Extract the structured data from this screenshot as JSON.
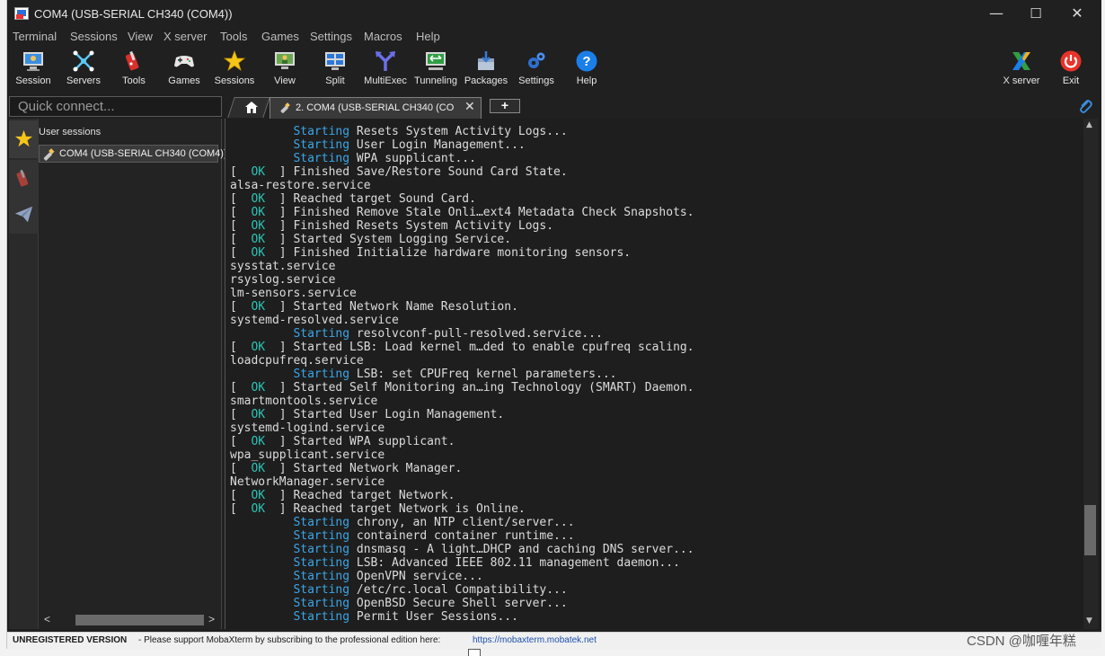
{
  "window": {
    "title": "COM4  (USB-SERIAL CH340 (COM4))",
    "controls": {
      "minimize": "—",
      "maximize": "☐",
      "close": "✕"
    }
  },
  "menubar": [
    "Terminal",
    "Sessions",
    "View",
    "X server",
    "Tools",
    "Games",
    "Settings",
    "Macros",
    "Help"
  ],
  "toolbar": {
    "items": [
      {
        "label": "Session",
        "icon": "session-monitor-icon"
      },
      {
        "label": "Servers",
        "icon": "servers-network-icon"
      },
      {
        "label": "Tools",
        "icon": "tools-knife-icon"
      },
      {
        "label": "Games",
        "icon": "gamepad-icon"
      },
      {
        "label": "Sessions",
        "icon": "star-icon"
      },
      {
        "label": "View",
        "icon": "view-monitor-icon"
      },
      {
        "label": "Split",
        "icon": "split-window-icon"
      },
      {
        "label": "MultiExec",
        "icon": "fork-arrows-icon"
      },
      {
        "label": "Tunneling",
        "icon": "tunnel-monitor-icon"
      },
      {
        "label": "Packages",
        "icon": "package-download-icon"
      },
      {
        "label": "Settings",
        "icon": "gears-icon"
      },
      {
        "label": "Help",
        "icon": "help-question-icon"
      }
    ],
    "right_items": [
      {
        "label": "X server",
        "icon": "x-server-icon"
      },
      {
        "label": "Exit",
        "icon": "power-icon"
      }
    ]
  },
  "quick_connect": {
    "placeholder": "Quick connect..."
  },
  "tabs": {
    "active_label": "2. COM4  (USB-SERIAL CH340 (CO",
    "close_glyph": "✕",
    "new_tab_glyph": "+"
  },
  "sessions_panel": {
    "header": "User sessions",
    "items": [
      {
        "label": "COM4  (USB-SERIAL CH340 (COM4))"
      }
    ],
    "scroll_left": "<",
    "scroll_right": ">"
  },
  "terminal": {
    "lines": [
      {
        "pre": "         ",
        "tag": "Starting",
        "rest": " Resets System Activity Logs...",
        "kind": "start"
      },
      {
        "pre": "         ",
        "tag": "Starting",
        "rest": " User Login Management...",
        "kind": "start"
      },
      {
        "pre": "         ",
        "tag": "Starting",
        "rest": " WPA supplicant...",
        "kind": "start"
      },
      {
        "pre": "[  ",
        "tag": "OK",
        "rest": "  ] Finished Save/Restore Sound Card State.",
        "kind": "ok"
      },
      {
        "pre": "alsa-restore.service",
        "tag": "",
        "rest": "",
        "kind": "plain"
      },
      {
        "pre": "[  ",
        "tag": "OK",
        "rest": "  ] Reached target Sound Card.",
        "kind": "ok"
      },
      {
        "pre": "[  ",
        "tag": "OK",
        "rest": "  ] Finished Remove Stale Onli…ext4 Metadata Check Snapshots.",
        "kind": "ok"
      },
      {
        "pre": "[  ",
        "tag": "OK",
        "rest": "  ] Finished Resets System Activity Logs.",
        "kind": "ok"
      },
      {
        "pre": "[  ",
        "tag": "OK",
        "rest": "  ] Started System Logging Service.",
        "kind": "ok"
      },
      {
        "pre": "[  ",
        "tag": "OK",
        "rest": "  ] Finished Initialize hardware monitoring sensors.",
        "kind": "ok"
      },
      {
        "pre": "sysstat.service",
        "tag": "",
        "rest": "",
        "kind": "plain"
      },
      {
        "pre": "rsyslog.service",
        "tag": "",
        "rest": "",
        "kind": "plain"
      },
      {
        "pre": "lm-sensors.service",
        "tag": "",
        "rest": "",
        "kind": "plain"
      },
      {
        "pre": "[  ",
        "tag": "OK",
        "rest": "  ] Started Network Name Resolution.",
        "kind": "ok"
      },
      {
        "pre": "systemd-resolved.service",
        "tag": "",
        "rest": "",
        "kind": "plain"
      },
      {
        "pre": "         ",
        "tag": "Starting",
        "rest": " resolvconf-pull-resolved.service...",
        "kind": "start"
      },
      {
        "pre": "[  ",
        "tag": "OK",
        "rest": "  ] Started LSB: Load kernel m…ded to enable cpufreq scaling.",
        "kind": "ok"
      },
      {
        "pre": "loadcpufreq.service",
        "tag": "",
        "rest": "",
        "kind": "plain"
      },
      {
        "pre": "         ",
        "tag": "Starting",
        "rest": " LSB: set CPUFreq kernel parameters...",
        "kind": "start"
      },
      {
        "pre": "[  ",
        "tag": "OK",
        "rest": "  ] Started Self Monitoring an…ing Technology (SMART) Daemon.",
        "kind": "ok"
      },
      {
        "pre": "smartmontools.service",
        "tag": "",
        "rest": "",
        "kind": "plain"
      },
      {
        "pre": "[  ",
        "tag": "OK",
        "rest": "  ] Started User Login Management.",
        "kind": "ok"
      },
      {
        "pre": "systemd-logind.service",
        "tag": "",
        "rest": "",
        "kind": "plain"
      },
      {
        "pre": "[  ",
        "tag": "OK",
        "rest": "  ] Started WPA supplicant.",
        "kind": "ok"
      },
      {
        "pre": "wpa_supplicant.service",
        "tag": "",
        "rest": "",
        "kind": "plain"
      },
      {
        "pre": "[  ",
        "tag": "OK",
        "rest": "  ] Started Network Manager.",
        "kind": "ok"
      },
      {
        "pre": "NetworkManager.service",
        "tag": "",
        "rest": "",
        "kind": "plain"
      },
      {
        "pre": "[  ",
        "tag": "OK",
        "rest": "  ] Reached target Network.",
        "kind": "ok"
      },
      {
        "pre": "[  ",
        "tag": "OK",
        "rest": "  ] Reached target Network is Online.",
        "kind": "ok"
      },
      {
        "pre": "         ",
        "tag": "Starting",
        "rest": " chrony, an NTP client/server...",
        "kind": "start"
      },
      {
        "pre": "         ",
        "tag": "Starting",
        "rest": " containerd container runtime...",
        "kind": "start"
      },
      {
        "pre": "         ",
        "tag": "Starting",
        "rest": " dnsmasq - A light…DHCP and caching DNS server...",
        "kind": "start"
      },
      {
        "pre": "         ",
        "tag": "Starting",
        "rest": " LSB: Advanced IEEE 802.11 management daemon...",
        "kind": "start"
      },
      {
        "pre": "         ",
        "tag": "Starting",
        "rest": " OpenVPN service...",
        "kind": "start"
      },
      {
        "pre": "         ",
        "tag": "Starting",
        "rest": " /etc/rc.local Compatibility...",
        "kind": "start"
      },
      {
        "pre": "         ",
        "tag": "Starting",
        "rest": " OpenBSD Secure Shell server...",
        "kind": "start"
      },
      {
        "pre": "         ",
        "tag": "Starting",
        "rest": " Permit User Sessions...",
        "kind": "start"
      }
    ]
  },
  "statusbar": {
    "unregistered": "UNREGISTERED VERSION",
    "message": " -  Please support MobaXterm by subscribing to the professional edition here:",
    "link": "https://mobaxterm.mobatek.net"
  },
  "watermark": "CSDN @咖喱年糕",
  "colors": {
    "background": "#202020",
    "terminal_bg": "#1e1e1e",
    "ok_tag": "#2ec4b6",
    "starting_tag": "#3aa6e8",
    "help_blue": "#1a7fe8",
    "exit_red": "#e8332a"
  }
}
